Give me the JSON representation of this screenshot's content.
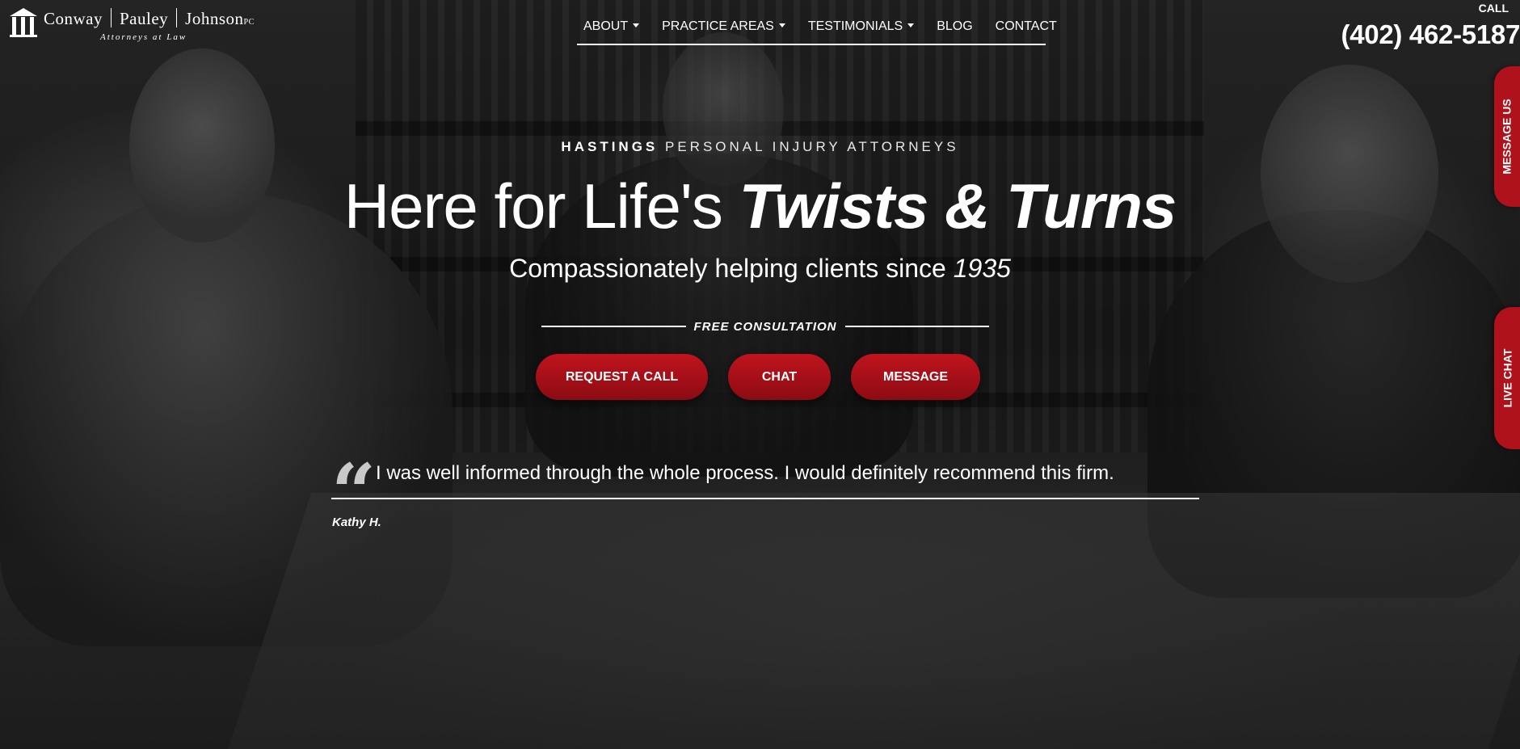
{
  "logo": {
    "name_1": "Conway",
    "name_2": "Pauley",
    "name_3": "Johnson",
    "suffix": "PC",
    "tagline": "Attorneys at Law"
  },
  "nav": {
    "items": [
      {
        "label": "ABOUT",
        "dropdown": true
      },
      {
        "label": "PRACTICE AREAS",
        "dropdown": true
      },
      {
        "label": "TESTIMONIALS",
        "dropdown": true
      },
      {
        "label": "BLOG",
        "dropdown": false
      },
      {
        "label": "CONTACT",
        "dropdown": false
      }
    ]
  },
  "call": {
    "label": "CALL",
    "phone": "(402) 462-5187"
  },
  "side_tabs": {
    "message": "MESSAGE US",
    "chat": "LIVE CHAT"
  },
  "hero": {
    "eyebrow_bold": "HASTINGS",
    "eyebrow_light": "PERSONAL INJURY ATTORNEYS",
    "headline_plain": "Here for Life's",
    "headline_emph": "Twists & Turns",
    "subhead_plain": "Compassionately helping clients since",
    "subhead_year": "1935",
    "consult_label": "FREE CONSULTATION"
  },
  "buttons": {
    "request_call": "REQUEST A CALL",
    "chat": "CHAT",
    "message": "MESSAGE"
  },
  "testimonial": {
    "quote": "I was well informed through the whole process. I would definitely recommend this firm.",
    "author": "Kathy H."
  },
  "colors": {
    "accent_red": "#b0121b",
    "text": "#ffffff"
  }
}
